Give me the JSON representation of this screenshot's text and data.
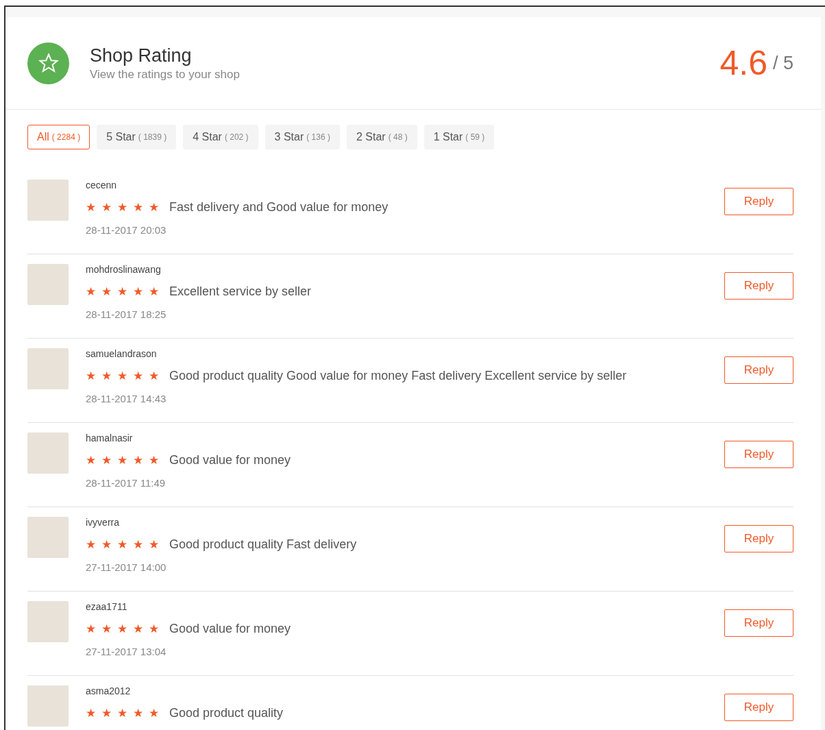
{
  "header": {
    "title": "Shop Rating",
    "subtitle": "View the ratings to your shop",
    "score": "4.6",
    "out_of": "/ 5"
  },
  "filters": [
    {
      "label": "All",
      "count": "( 2284 )",
      "selected": true
    },
    {
      "label": "5 Star",
      "count": "( 1839 )",
      "selected": false
    },
    {
      "label": "4 Star",
      "count": "( 202 )",
      "selected": false
    },
    {
      "label": "3 Star",
      "count": "( 136 )",
      "selected": false
    },
    {
      "label": "2 Star",
      "count": "( 48 )",
      "selected": false
    },
    {
      "label": "1 Star",
      "count": "( 59 )",
      "selected": false
    }
  ],
  "reviews": [
    {
      "user": "cecenn",
      "stars": 5,
      "comment": "Fast delivery and Good value for money",
      "time": "28-11-2017 20:03",
      "action": "Reply"
    },
    {
      "user": "mohdroslinawang",
      "stars": 5,
      "comment": "Excellent service by seller",
      "time": "28-11-2017 18:25",
      "action": "Reply"
    },
    {
      "user": "samuelandrason",
      "stars": 5,
      "comment": "Good product quality Good value for money Fast delivery Excellent service by seller",
      "time": "28-11-2017 14:43",
      "action": "Reply"
    },
    {
      "user": "hamalnasir",
      "stars": 5,
      "comment": "Good value for money",
      "time": "28-11-2017 11:49",
      "action": "Reply"
    },
    {
      "user": "ivyverra",
      "stars": 5,
      "comment": "Good product quality Fast delivery",
      "time": "27-11-2017 14:00",
      "action": "Reply"
    },
    {
      "user": "ezaa1711",
      "stars": 5,
      "comment": "Good value for money",
      "time": "27-11-2017 13:04",
      "action": "Reply"
    },
    {
      "user": "asma2012",
      "stars": 5,
      "comment": "Good product quality",
      "action": "Reply"
    }
  ]
}
